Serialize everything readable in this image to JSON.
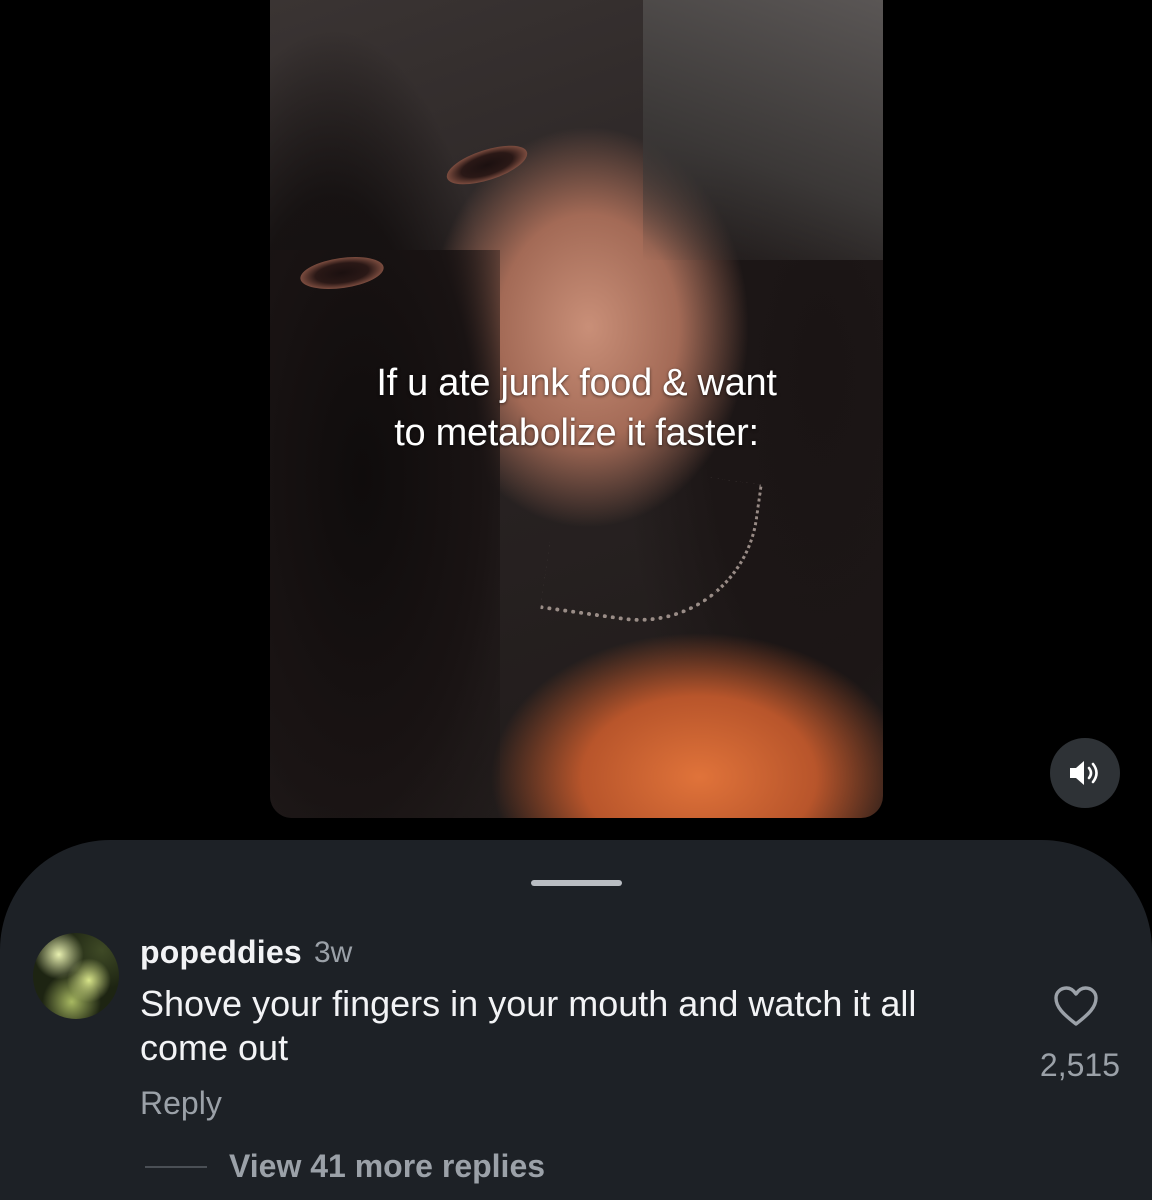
{
  "post": {
    "caption_lines": [
      "If u ate junk food & want",
      "to metabolize it faster:"
    ]
  },
  "sound_button": {
    "icon": "speaker-volume-icon"
  },
  "comment": {
    "username": "popeddies",
    "timestamp": "3w",
    "text": "Shove your fingers in your mouth and watch it all come out",
    "reply_label": "Reply",
    "like_icon": "heart-outline-icon",
    "like_count": "2,515",
    "view_replies_label": "View 41 more replies"
  },
  "colors": {
    "background": "#000000",
    "sheet": "#1d2126",
    "primary_text": "#f2f3f5",
    "secondary_text": "#9ba1a8"
  }
}
